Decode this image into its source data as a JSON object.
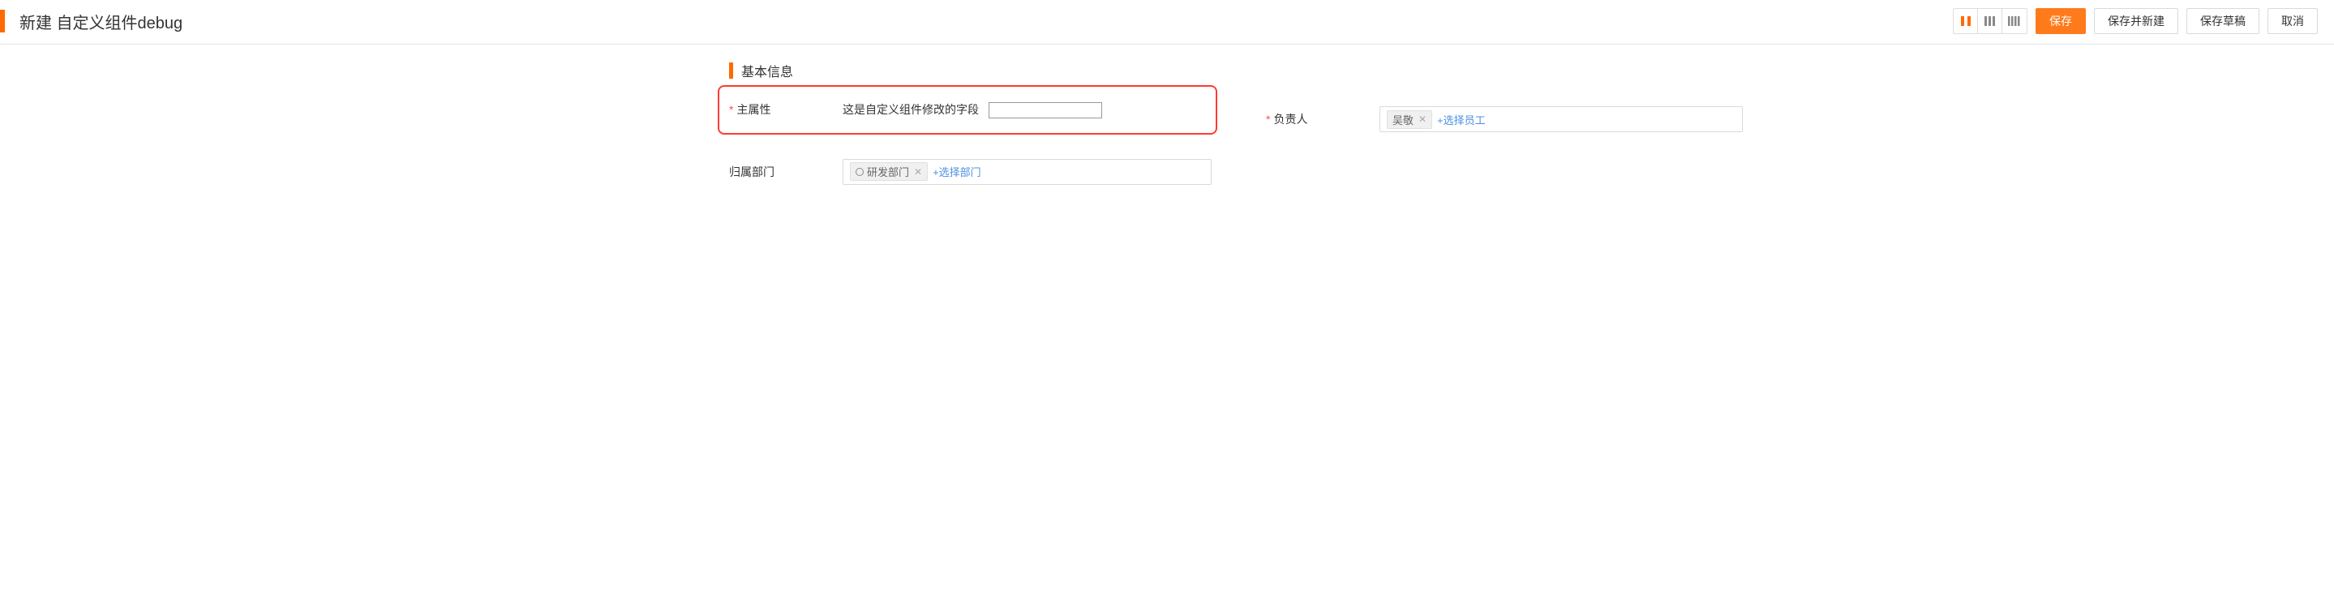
{
  "header": {
    "title": "新建 自定义组件debug",
    "buttons": {
      "save": "保存",
      "save_and_new": "保存并新建",
      "save_draft": "保存草稿",
      "cancel": "取消"
    }
  },
  "section": {
    "title": "基本信息"
  },
  "fields": {
    "main_attr": {
      "label": "主属性",
      "custom_text": "这是自定义组件修改的字段",
      "value": ""
    },
    "owner": {
      "label": "负责人",
      "tag": "吴敬",
      "add_link": "+选择员工"
    },
    "department": {
      "label": "归属部门",
      "tag": "研发部门",
      "add_link": "+选择部门"
    }
  }
}
